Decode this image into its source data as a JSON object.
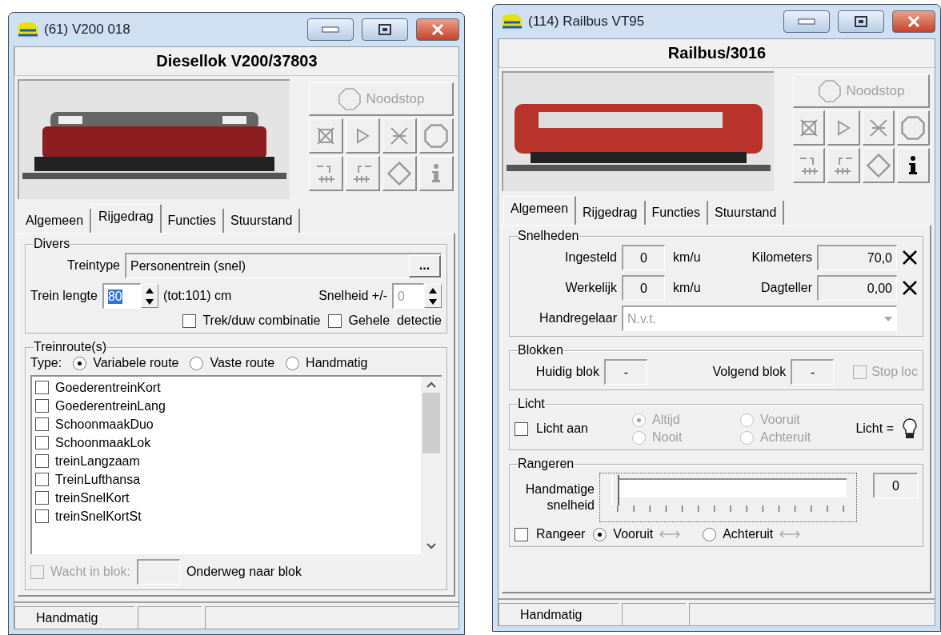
{
  "windows": [
    {
      "kind": "rijgedrag",
      "title": "(61) V200 018",
      "heading": "Diesellok V200/37803",
      "emergency_button": "Noodstop",
      "info_enabled": false,
      "tabs": [
        {
          "label": "Algemeen",
          "selected": false
        },
        {
          "label": "Rijgedrag",
          "selected": true
        },
        {
          "label": "Functies",
          "selected": false
        },
        {
          "label": "Stuurstand",
          "selected": false
        }
      ],
      "divers": {
        "legend": "Divers",
        "type_label": "Treintype",
        "type_value": "Personentrein (snel)",
        "browse_button": "...",
        "length_label": "Trein lengte",
        "length_value": "80",
        "length_note": "(tot:101) cm",
        "speed_label": "Snelheid +/-",
        "speed_value": "0",
        "checkboxes": [
          {
            "label": "Trek/duw combinatie",
            "checked": false
          },
          {
            "label": "Gehele  detectie",
            "checked": false
          }
        ]
      },
      "routes": {
        "legend": "Treinroute(s)",
        "type_label": "Type:",
        "options": [
          {
            "label": "Variabele route",
            "selected": true
          },
          {
            "label": "Vaste route",
            "selected": false
          },
          {
            "label": "Handmatig",
            "selected": false
          }
        ],
        "items": [
          {
            "label": "GoederentreinKort",
            "checked": false
          },
          {
            "label": "GoederentreinLang",
            "checked": false
          },
          {
            "label": "SchoonmaakDuo",
            "checked": false
          },
          {
            "label": "SchoonmaakLok",
            "checked": false
          },
          {
            "label": "treinLangzaam",
            "checked": false
          },
          {
            "label": "TreinLufthansa",
            "checked": false
          },
          {
            "label": "treinSnelKort",
            "checked": false
          },
          {
            "label": "treinSnelKortSt",
            "checked": false
          }
        ],
        "wait": {
          "label": "Wacht in blok:",
          "checked": false,
          "disabled": true
        },
        "destination_label": "Onderweg naar blok"
      },
      "status_bar": {
        "mode": "Handmatig"
      }
    },
    {
      "kind": "algemeen",
      "title": "(114) Railbus VT95",
      "heading": "Railbus/3016",
      "emergency_button": "Noodstop",
      "info_enabled": true,
      "tabs": [
        {
          "label": "Algemeen",
          "selected": true
        },
        {
          "label": "Rijgedrag",
          "selected": false
        },
        {
          "label": "Functies",
          "selected": false
        },
        {
          "label": "Stuurstand",
          "selected": false
        }
      ],
      "speeds": {
        "legend": "Snelheden",
        "rows": [
          {
            "label": "Ingesteld",
            "value": "0",
            "unit": "km/u",
            "counter_label": "Kilometers",
            "counter_value": "70,0"
          },
          {
            "label": "Werkelijk",
            "value": "0",
            "unit": "km/u",
            "counter_label": "Dagteller",
            "counter_value": "0,00"
          }
        ],
        "controller_label": "Handregelaar",
        "controller_value": "N.v.t."
      },
      "blocks": {
        "legend": "Blokken",
        "current_label": "Huidig blok",
        "current_value": "-",
        "next_label": "Volgend blok",
        "next_value": "-",
        "stop": {
          "label": "Stop loc",
          "checked": false,
          "disabled": true
        }
      },
      "light": {
        "legend": "Licht",
        "switch": {
          "label": "Licht aan",
          "checked": false
        },
        "options": [
          {
            "label": "Altijd",
            "selected": true
          },
          {
            "label": "Vooruit",
            "selected": false
          },
          {
            "label": "Nooit",
            "selected": false
          },
          {
            "label": "Achteruit",
            "selected": false
          }
        ],
        "options_disabled": true,
        "indicator_label": "Licht ="
      },
      "shunting": {
        "legend": "Rangeren",
        "slider_label": "Handmatige snelheid",
        "level": 0,
        "slider_value": "0",
        "switch": {
          "label": "Rangeer",
          "checked": false
        },
        "directions": [
          {
            "label": "Vooruit",
            "selected": true
          },
          {
            "label": "Achteruit",
            "selected": false
          }
        ]
      },
      "status_bar": {
        "mode": "Handmatig"
      }
    }
  ]
}
